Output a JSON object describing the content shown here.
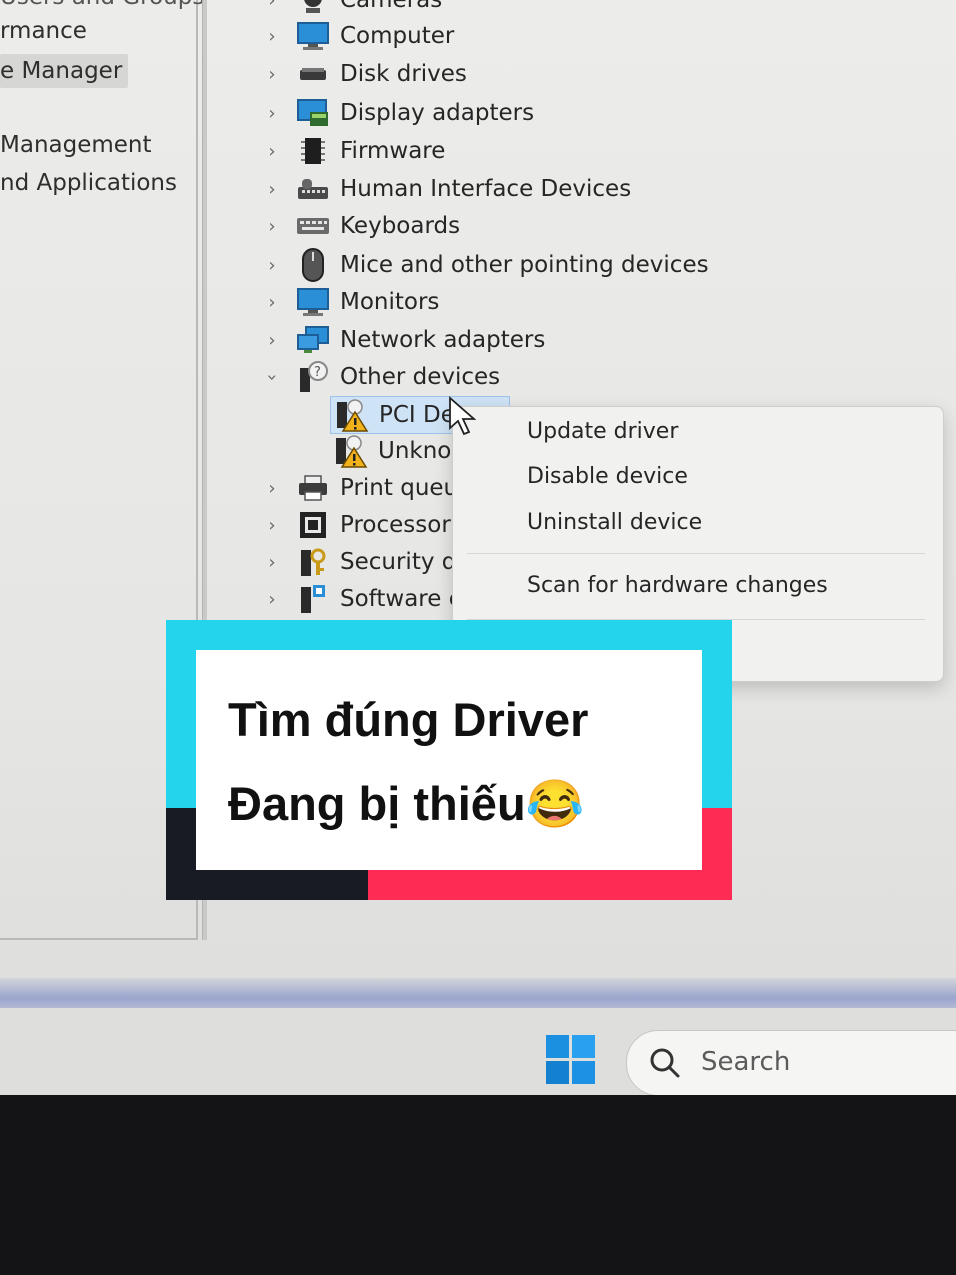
{
  "left_nav": {
    "items": [
      {
        "label": "Users and Groups",
        "selected": false
      },
      {
        "label": "rmance",
        "selected": false
      },
      {
        "label": "e Manager",
        "selected": true
      },
      {
        "label": "Management",
        "selected": false
      },
      {
        "label": "nd Applications",
        "selected": false
      }
    ]
  },
  "device_tree": {
    "categories": [
      {
        "label": "Cameras",
        "icon": "camera-icon",
        "expanded": false
      },
      {
        "label": "Computer",
        "icon": "computer-icon",
        "expanded": false
      },
      {
        "label": "Disk drives",
        "icon": "disk-drive-icon",
        "expanded": false
      },
      {
        "label": "Display adapters",
        "icon": "display-adapter-icon",
        "expanded": false
      },
      {
        "label": "Firmware",
        "icon": "firmware-icon",
        "expanded": false
      },
      {
        "label": "Human Interface Devices",
        "icon": "hid-icon",
        "expanded": false
      },
      {
        "label": "Keyboards",
        "icon": "keyboard-icon",
        "expanded": false
      },
      {
        "label": "Mice and other pointing devices",
        "icon": "mouse-icon",
        "expanded": false
      },
      {
        "label": "Monitors",
        "icon": "monitor-icon",
        "expanded": false
      },
      {
        "label": "Network adapters",
        "icon": "network-adapter-icon",
        "expanded": false
      },
      {
        "label": "Other devices",
        "icon": "unknown-device-icon",
        "expanded": true
      },
      {
        "label": "Print queu",
        "icon": "printer-icon",
        "expanded": false
      },
      {
        "label": "Processors",
        "icon": "processor-icon",
        "expanded": false
      },
      {
        "label": "Security de",
        "icon": "security-device-icon",
        "expanded": false
      },
      {
        "label": "Software c",
        "icon": "software-component-icon",
        "expanded": false
      }
    ],
    "other_devices_children": [
      {
        "label": "PCI Dev",
        "icon": "warning-device-icon",
        "selected": true
      },
      {
        "label": "Unkno",
        "icon": "warning-device-icon",
        "selected": false
      }
    ]
  },
  "context_menu": {
    "items": [
      "Update driver",
      "Disable device",
      "Uninstall device",
      "Scan for hardware changes"
    ]
  },
  "taskbar": {
    "search_label": "Search"
  },
  "caption": {
    "line1": "Tìm đúng Driver",
    "line2": "Đang bị thiếu😂"
  },
  "colors": {
    "caption_cyan": "#23d4ec",
    "caption_red": "#fe2c55",
    "caption_dark": "#181a24",
    "selection": "#cfe3f6",
    "warning": "#f2b21b"
  }
}
